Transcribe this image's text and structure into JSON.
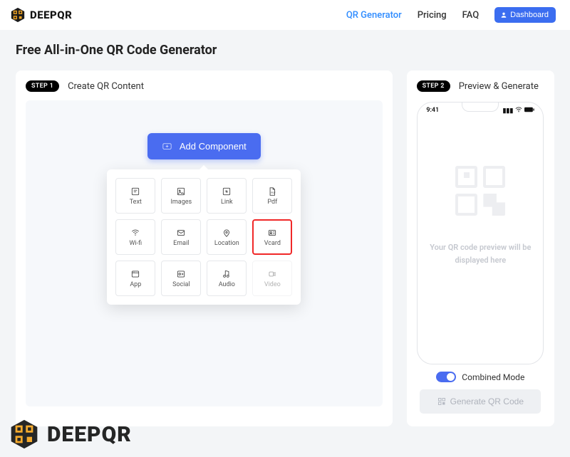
{
  "brand": {
    "name": "DEEPQR"
  },
  "nav": {
    "qr_generator": "QR Generator",
    "pricing": "Pricing",
    "faq": "FAQ",
    "dashboard": "Dashboard"
  },
  "page": {
    "title": "Free All-in-One QR Code Generator"
  },
  "step1": {
    "badge": "STEP 1",
    "title": "Create QR Content",
    "add_component": "Add Component",
    "components": [
      {
        "key": "text",
        "label": "Text",
        "icon": "text-icon"
      },
      {
        "key": "images",
        "label": "Images",
        "icon": "image-icon"
      },
      {
        "key": "link",
        "label": "Link",
        "icon": "link-icon"
      },
      {
        "key": "pdf",
        "label": "Pdf",
        "icon": "pdf-icon"
      },
      {
        "key": "wifi",
        "label": "Wi-fi",
        "icon": "wifi-icon"
      },
      {
        "key": "email",
        "label": "Email",
        "icon": "email-icon"
      },
      {
        "key": "location",
        "label": "Location",
        "icon": "location-icon"
      },
      {
        "key": "vcard",
        "label": "Vcard",
        "icon": "vcard-icon",
        "highlight": true
      },
      {
        "key": "app",
        "label": "App",
        "icon": "app-icon"
      },
      {
        "key": "social",
        "label": "Social",
        "icon": "social-icon"
      },
      {
        "key": "audio",
        "label": "Audio",
        "icon": "audio-icon"
      },
      {
        "key": "video",
        "label": "Video",
        "icon": "video-icon",
        "disabled": true
      }
    ]
  },
  "step2": {
    "badge": "STEP 2",
    "title": "Preview & Generate",
    "phone_time": "9:41",
    "preview_text": "Your QR code preview will be displayed here",
    "combined_mode": "Combined Mode",
    "generate": "Generate QR Code"
  },
  "watermark": {
    "text": "DEEPQR"
  }
}
